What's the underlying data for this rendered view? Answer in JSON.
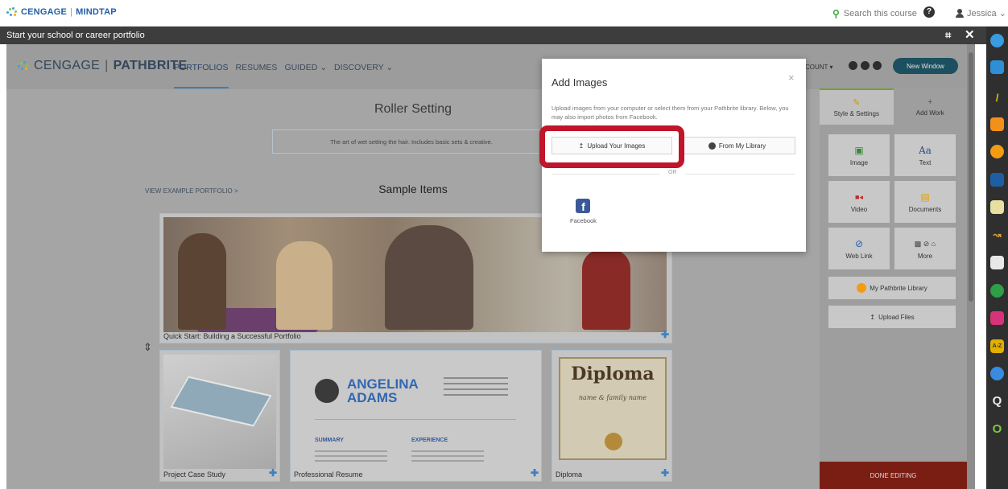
{
  "topbar": {
    "brand_left": "CENGAGE",
    "brand_sep": "|",
    "brand_right": "MINDTAP",
    "search_label": "Search this course",
    "help_glyph": "?",
    "user_name": "Jessica ⌄"
  },
  "appbar": {
    "title": "Start your school or career portfolio",
    "expand_glyph": "⌗",
    "close_glyph": "✕"
  },
  "pathbrite": {
    "brand_a": "CENGAGE",
    "brand_sep": "|",
    "brand_b": "PATHBRITE",
    "nav": [
      "PORTFOLIOS",
      "RESUMES",
      "GUIDED ⌄",
      "DISCOVERY ⌄"
    ],
    "account": "COUNT ▾",
    "new_window": "New Window"
  },
  "portfolio": {
    "title": "Roller Setting",
    "description": "The art of wet setting the hair. Includes basic sets & creative.",
    "view_example": "VIEW EXAMPLE PORTFOLIO  >",
    "section_title": "Sample Items",
    "cards": {
      "hero": "Quick Start: Building a Successful Portfolio",
      "project": "Project Case Study",
      "resume": "Professional Resume",
      "diploma": "Diploma"
    },
    "plus_glyph": "✚",
    "drag_glyph": "⇕",
    "resume": {
      "first": "ANGELINA",
      "last": "ADAMS",
      "summary": "SUMMARY",
      "experience": "EXPERIENCE"
    },
    "diploma": {
      "heading": "Diploma",
      "name": "name & family name"
    }
  },
  "editor": {
    "tab_style": "Style & Settings",
    "tab_add": "Add Work",
    "tiles": [
      {
        "label": "Image",
        "icon": "image-icon",
        "glyph": "▣",
        "color": "#3a8a3a"
      },
      {
        "label": "Text",
        "icon": "text-icon",
        "glyph": "Aa",
        "color": "#2a4a8a"
      },
      {
        "label": "Video",
        "icon": "video-icon",
        "glyph": "■◂",
        "color": "#c62828"
      },
      {
        "label": "Documents",
        "icon": "document-icon",
        "glyph": "▤",
        "color": "#e6a000"
      },
      {
        "label": "Web Link",
        "icon": "link-icon",
        "glyph": "⊘",
        "color": "#2a5aa0"
      },
      {
        "label": "More",
        "icon": "more-icon",
        "glyph": "▩ ⊘ ⌂",
        "color": "#444444"
      }
    ],
    "library": "My Pathbrite Library",
    "upload_files": "Upload Files",
    "done": "DONE EDITING"
  },
  "modal": {
    "title": "Add Images",
    "close": "×",
    "description": "Upload images from your computer or select them from your Pathbrite library. Below, you may also import photos from Facebook.",
    "upload_button": "Upload Your Images",
    "library_button": "From My Library",
    "or": "OR",
    "facebook": "Facebook",
    "facebook_glyph": "f"
  },
  "colors": {
    "highlight": "#c0152a",
    "done_bg": "#7a1e14",
    "new_window_bg": "#1c4f5f"
  }
}
